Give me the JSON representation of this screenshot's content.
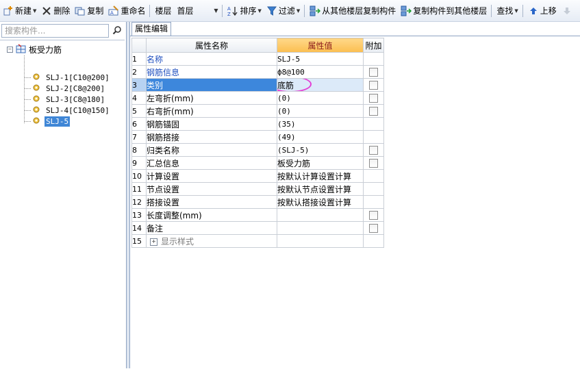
{
  "toolbar": {
    "new_label": "新建",
    "delete_label": "删除",
    "copy_label": "复制",
    "rename_label": "重命名",
    "floor_label": "楼层",
    "floor_value": "首层",
    "sort_label": "排序",
    "filter_label": "过滤",
    "copy_from_floor_label": "从其他楼层复制构件",
    "copy_to_floor_label": "复制构件到其他楼层",
    "find_label": "查找",
    "move_up_label": "上移"
  },
  "left": {
    "search_placeholder": "搜索构件...",
    "tree": {
      "root_label": "板受力筋",
      "root_expander": "−",
      "items": [
        {
          "label": "SLJ-1[C10@200]",
          "selected": false
        },
        {
          "label": "SLJ-2[C8@200]",
          "selected": false
        },
        {
          "label": "SLJ-3[C8@180]",
          "selected": false
        },
        {
          "label": "SLJ-4[C10@150]",
          "selected": false
        },
        {
          "label": "SLJ-5",
          "selected": true
        }
      ]
    }
  },
  "right": {
    "tab_label": "属性编辑",
    "grid": {
      "headers": {
        "name": "属性名称",
        "value": "属性值",
        "add": "附加"
      },
      "rows": [
        {
          "num": "1",
          "name": "名称",
          "value": "SLJ-5",
          "checkbox": false,
          "blue": true
        },
        {
          "num": "2",
          "name": "钢筋信息",
          "value": "ф8@100",
          "checkbox": true,
          "blue": true
        },
        {
          "num": "3",
          "name": "类别",
          "value": "底筋",
          "checkbox": true,
          "blue": false,
          "selected": true
        },
        {
          "num": "4",
          "name": "左弯折(mm)",
          "value": "(0)",
          "checkbox": true,
          "blue": false
        },
        {
          "num": "5",
          "name": "右弯折(mm)",
          "value": "(0)",
          "checkbox": true,
          "blue": false
        },
        {
          "num": "6",
          "name": "钢筋锚固",
          "value": "(35)",
          "checkbox": false,
          "blue": false
        },
        {
          "num": "7",
          "name": "钢筋搭接",
          "value": "(49)",
          "checkbox": false,
          "blue": false
        },
        {
          "num": "8",
          "name": "归类名称",
          "value": "(SLJ-5)",
          "checkbox": true,
          "blue": false
        },
        {
          "num": "9",
          "name": "汇总信息",
          "value": "板受力筋",
          "checkbox": true,
          "blue": false
        },
        {
          "num": "10",
          "name": "计算设置",
          "value": "按默认计算设置计算",
          "checkbox": false,
          "blue": false
        },
        {
          "num": "11",
          "name": "节点设置",
          "value": "按默认节点设置计算",
          "checkbox": false,
          "blue": false
        },
        {
          "num": "12",
          "name": "搭接设置",
          "value": "按默认搭接设置计算",
          "checkbox": false,
          "blue": false
        },
        {
          "num": "13",
          "name": "长度调整(mm)",
          "value": "",
          "checkbox": true,
          "blue": false
        },
        {
          "num": "14",
          "name": "备注",
          "value": "",
          "checkbox": true,
          "blue": false
        },
        {
          "num": "15",
          "name": "显示样式",
          "value": "",
          "checkbox": false,
          "blue": false,
          "expandable": true,
          "expand_symbol": "+"
        }
      ]
    },
    "highlight_color": "#e33fd6"
  }
}
